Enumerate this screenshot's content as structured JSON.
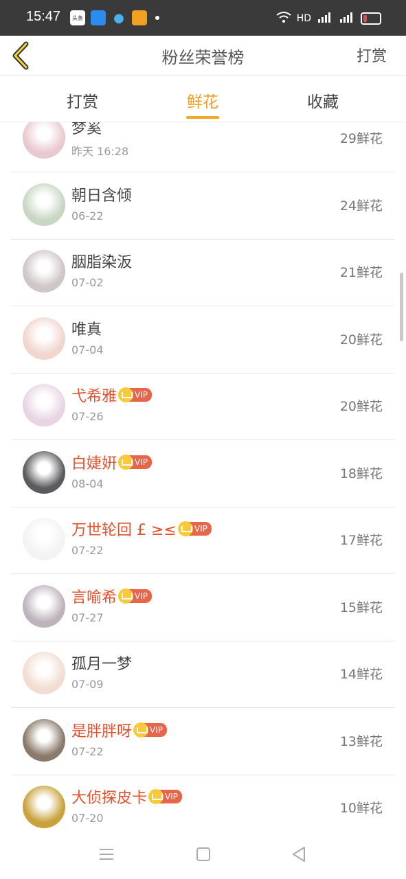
{
  "status_bar": {
    "time": "15:47",
    "left_apps": [
      "头条",
      "",
      "",
      ""
    ],
    "right_text": "HD"
  },
  "header": {
    "title": "粉丝荣誉榜",
    "right_label": "打赏"
  },
  "tabs": [
    {
      "label": "打赏",
      "active": false
    },
    {
      "label": "鲜花",
      "active": true
    },
    {
      "label": "收藏",
      "active": false
    }
  ],
  "vip_label": "VIP",
  "list": [
    {
      "name": "梦奚",
      "date": "昨天 16:28",
      "count": "29鲜花",
      "vip": false,
      "avatar_color": "#e9c9cf"
    },
    {
      "name": "朝日含倾",
      "date": "06-22",
      "count": "24鲜花",
      "vip": false,
      "avatar_color": "#c9d6c3"
    },
    {
      "name": "胭脂染汳",
      "date": "07-02",
      "count": "21鲜花",
      "vip": false,
      "avatar_color": "#cfc6c6"
    },
    {
      "name": "唯真",
      "date": "07-04",
      "count": "20鲜花",
      "vip": false,
      "avatar_color": "#f1d6d0"
    },
    {
      "name": "弋希雅",
      "date": "07-26",
      "count": "20鲜花",
      "vip": true,
      "avatar_color": "#e8d4e4"
    },
    {
      "name": "白婕姸",
      "date": "08-04",
      "count": "18鲜花",
      "vip": true,
      "avatar_color": "#5b5b5e"
    },
    {
      "name": "万世轮回 £ ≥≤",
      "date": "07-22",
      "count": "17鲜花",
      "vip": true,
      "avatar_color": "#f3f3f3"
    },
    {
      "name": "言喻希",
      "date": "07-27",
      "count": "15鲜花",
      "vip": true,
      "avatar_color": "#bdb3bc"
    },
    {
      "name": "孤月一梦",
      "date": "07-09",
      "count": "14鲜花",
      "vip": false,
      "avatar_color": "#f2ddd2"
    },
    {
      "name": "是胖胖呀",
      "date": "07-22",
      "count": "13鲜花",
      "vip": true,
      "avatar_color": "#8a7a6a"
    },
    {
      "name": "大侦探皮卡",
      "date": "07-20",
      "count": "10鲜花",
      "vip": true,
      "avatar_color": "#c9a23d"
    }
  ],
  "colors": {
    "accent": "#f5a623",
    "vip_name": "#e5512c"
  },
  "navbar_icons": [
    "menu-icon",
    "home-square-icon",
    "back-triangle-icon"
  ]
}
